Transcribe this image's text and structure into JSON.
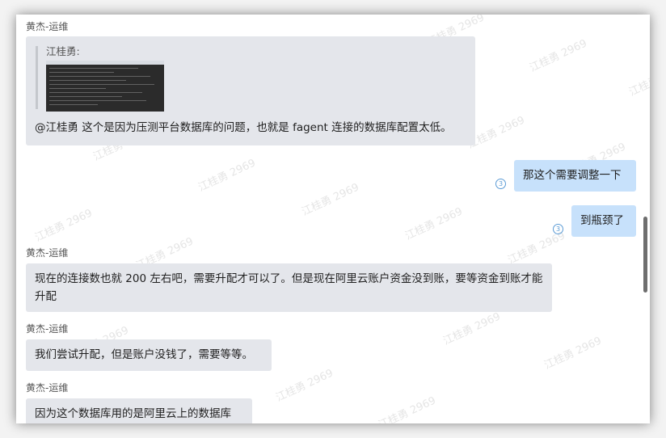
{
  "watermark": "江桂勇 2969",
  "messages": [
    {
      "sender": "黄杰-运维",
      "quote_author": "江桂勇:",
      "text": "@江桂勇  这个是因为压测平台数据库的问题，也就是 fagent 连接的数据库配置太低。"
    },
    {
      "mine": true,
      "text": "那这个需要调整一下",
      "read_count": "3"
    },
    {
      "mine": true,
      "text": "到瓶颈了",
      "read_count": "3"
    },
    {
      "sender": "黄杰-运维",
      "text": "现在的连接数也就 200 左右吧，需要升配才可以了。但是现在阿里云账户资金没到账，要等资金到账才能升配"
    },
    {
      "sender": "黄杰-运维",
      "text": "我们尝试升配，但是账户没钱了，需要等等。"
    },
    {
      "sender": "黄杰-运维",
      "text": "因为这个数据库用的是阿里云上的数据库"
    }
  ],
  "colors": {
    "incoming_bubble": "#e4e6eb",
    "outgoing_bubble": "#c7e1fb",
    "read_indicator": "#5b9bd5"
  }
}
